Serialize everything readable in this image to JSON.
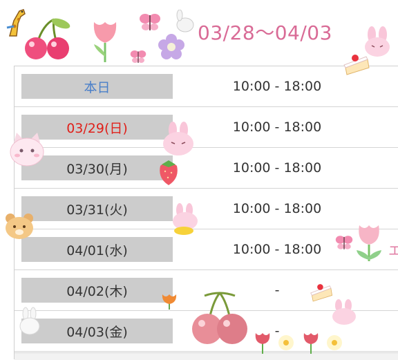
{
  "header": {
    "title": "03/28〜04/03"
  },
  "schedule": {
    "rows": [
      {
        "day": "本日",
        "hours": "10:00 - 18:00",
        "day_color": "#4a7fc9"
      },
      {
        "day": "03/29(日)",
        "hours": "10:00 - 18:00",
        "day_color": "#e0201a"
      },
      {
        "day": "03/30(月)",
        "hours": "10:00 - 18:00",
        "day_color": "#333333"
      },
      {
        "day": "03/31(火)",
        "hours": "10:00 - 18:00",
        "day_color": "#333333"
      },
      {
        "day": "04/01(水)",
        "hours": "10:00 - 18:00",
        "day_color": "#333333"
      },
      {
        "day": "04/02(木)",
        "hours": "-",
        "day_color": "#333333"
      },
      {
        "day": "04/03(金)",
        "hours": "-",
        "day_color": "#333333"
      }
    ]
  },
  "side": {
    "cut_text": "エ"
  },
  "colors": {
    "title": "#d96b96",
    "box": "#cccccc",
    "border": "#cfcfcf"
  },
  "stickers": [
    "giraffe",
    "cherries",
    "tulip",
    "butterfly",
    "flower",
    "rabbit",
    "cake",
    "cat",
    "strawberry",
    "bear",
    "tulip-small",
    "bunny-small",
    "dango-flowers"
  ]
}
